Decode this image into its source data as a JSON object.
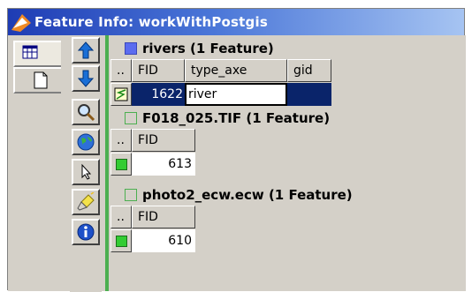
{
  "window": {
    "title": "Feature Info: workWithPostgis"
  },
  "tabs": [
    {
      "name": "table-view",
      "icon": "table-icon",
      "active": true
    },
    {
      "name": "document-view",
      "icon": "document-icon",
      "active": false
    }
  ],
  "toolbar": [
    {
      "name": "move-up",
      "icon": "arrow-up-icon"
    },
    {
      "name": "move-down",
      "icon": "arrow-down-icon"
    },
    {
      "name": "zoom",
      "icon": "magnifier-icon"
    },
    {
      "name": "globe",
      "icon": "globe-icon"
    },
    {
      "name": "select",
      "icon": "pointer-icon"
    },
    {
      "name": "highlight",
      "icon": "flashlight-icon"
    },
    {
      "name": "info",
      "icon": "info-icon"
    }
  ],
  "layers": [
    {
      "title": "rivers (1 Feature)",
      "swatch": "#5b6cf0",
      "columns": [
        "..",
        "FID",
        "type_axe",
        "gid"
      ],
      "row": {
        "fid": "1622",
        "type_axe": "river",
        "gid": ""
      },
      "selected": true
    },
    {
      "title": "F018_025.TIF (1 Feature)",
      "columns": [
        "..",
        "FID"
      ],
      "row": {
        "fid": "613"
      }
    },
    {
      "title": "photo2_ecw.ecw (1 Feature)",
      "columns": [
        "..",
        "FID"
      ],
      "row": {
        "fid": "610"
      }
    }
  ]
}
